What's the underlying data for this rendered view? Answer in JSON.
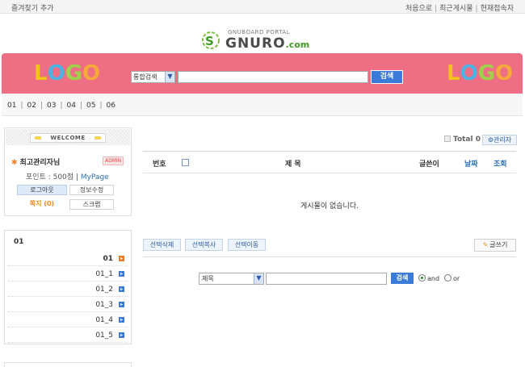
{
  "topbar": {
    "favorites": "즐겨찾기 추가",
    "links": [
      "처음으로",
      "최근게시물",
      "현재접속자"
    ]
  },
  "brand": {
    "small": "GNUBOARD PORTAL",
    "big": "GNURO",
    "suffix": ".com"
  },
  "header": {
    "logo_letters": [
      "L",
      "O",
      "G",
      "O"
    ],
    "search_select": "통합검색",
    "search_value": "",
    "search_button": "검색"
  },
  "menu": {
    "items": [
      "01",
      "02",
      "03",
      "04",
      "05",
      "06"
    ]
  },
  "login": {
    "welcome": "WELCOME",
    "user": "최고관리자님",
    "admin_badge": "ADMIN",
    "point_label": "포인트 : 500점",
    "mypage": "MyPage",
    "logout": "로그아웃",
    "edit_info": "정보수정",
    "memo": "쪽지 (0)",
    "scrap": "스크랩"
  },
  "board": {
    "total": "Total 0",
    "admin_button": "관리자",
    "columns": {
      "num": "번호",
      "subject": "제 목",
      "writer": "글쓴이",
      "date": "날짜",
      "hit": "조회"
    },
    "empty_message": "게시물이 없습니다.",
    "action_buttons": [
      "선택삭제",
      "선택복사",
      "선택이동"
    ],
    "write_button": "글쓰기",
    "search": {
      "field_select": "제목",
      "query": "",
      "button": "검색",
      "op_and": "and",
      "op_or": "or",
      "selected_op": "and"
    }
  },
  "categories": {
    "title": "01",
    "items": [
      "01",
      "01_1",
      "01_2",
      "01_3",
      "01_4",
      "01_5"
    ],
    "active": "01"
  },
  "colors": {
    "header_pink": "#ee6e84",
    "button_blue": "#3a7ad8",
    "accent_orange": "#f07a1f",
    "logo_yellow": "#f2c31b",
    "logo_blue": "#4db3e3",
    "logo_green": "#9fd24a",
    "logo_orange": "#f5a93a"
  }
}
